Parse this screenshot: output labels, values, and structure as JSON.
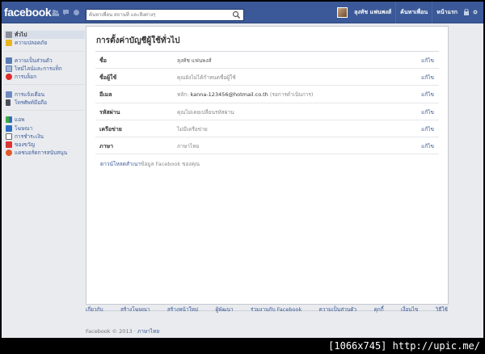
{
  "header": {
    "logo": "facebook",
    "search_placeholder": "ค้นหาเพื่อน สถานที่ และสิ่งต่างๆ",
    "user_name": "ลุงทัช แฟนพงส์",
    "find_friends": "ค้นหาเพื่อน",
    "home": "หน้าแรก"
  },
  "sidebar": {
    "group1": [
      {
        "label": "ทั่วไป",
        "icon": "gear-icon",
        "active": true
      },
      {
        "label": "ความปลอดภัย",
        "icon": "lock-icon"
      }
    ],
    "group2": [
      {
        "label": "ความเป็นส่วนตัว",
        "icon": "privacy-icon"
      },
      {
        "label": "ไทม์ไลน์และการแท็ก",
        "icon": "timeline-icon"
      },
      {
        "label": "การบล็อก",
        "icon": "block-icon"
      }
    ],
    "group3": [
      {
        "label": "การแจ้งเตือน",
        "icon": "notification-icon"
      },
      {
        "label": "โทรศัพท์มือถือ",
        "icon": "mobile-icon"
      }
    ],
    "group4": [
      {
        "label": "แอพ",
        "icon": "apps-icon"
      },
      {
        "label": "โฆษณา",
        "icon": "ads-icon"
      },
      {
        "label": "การชำระเงิน",
        "icon": "payments-icon"
      },
      {
        "label": "ของขวัญ",
        "icon": "gift-icon"
      },
      {
        "label": "แดชบอร์ดการสนับสนุน",
        "icon": "support-icon"
      }
    ]
  },
  "main": {
    "title": "การตั้งค่าบัญชีผู้ใช้ทั่วไป",
    "rows": [
      {
        "label": "ชื่อ",
        "value": "ลุงทัช แฟนพงส์",
        "value_dark": true,
        "edit": "แก้ไข"
      },
      {
        "label": "ชื่อผู้ใช้",
        "value": "คุณยังไม่ได้กำหนดชื่อผู้ใช้",
        "edit": "แก้ไข"
      },
      {
        "label": "อีเมล",
        "prefix": "หลัก: ",
        "email": "kanna-123456@hotmail.co.th",
        "suffix": " (รอการดำเนินการ)",
        "edit": "แก้ไข"
      },
      {
        "label": "รหัสผ่าน",
        "value": "คุณไม่เคยเปลี่ยนรหัสผ่าน",
        "edit": "แก้ไข"
      },
      {
        "label": "เครือข่าย",
        "value": "ไม่มีเครือข่าย",
        "edit": "แก้ไข"
      },
      {
        "label": "ภาษา",
        "value": "ภาษาไทย",
        "edit": "แก้ไข"
      }
    ],
    "download_link": "ดาวน์โหลดสำเนา",
    "download_text": "ข้อมูล Facebook ของคุณ"
  },
  "footer": {
    "links": [
      "เกี่ยวกับ",
      "สร้างโฆษณา",
      "สร้างหน้าใหม่",
      "ผู้พัฒนา",
      "ร่วมงานกับ Facebook",
      "ความเป็นส่วนตัว",
      "คุกกี้",
      "เงื่อนไข",
      "วิธีใช้"
    ],
    "copyright": "Facebook © 2013 · ",
    "language": "ภาษาไทย"
  },
  "watermark": "[1066x745] http://upic.me/"
}
